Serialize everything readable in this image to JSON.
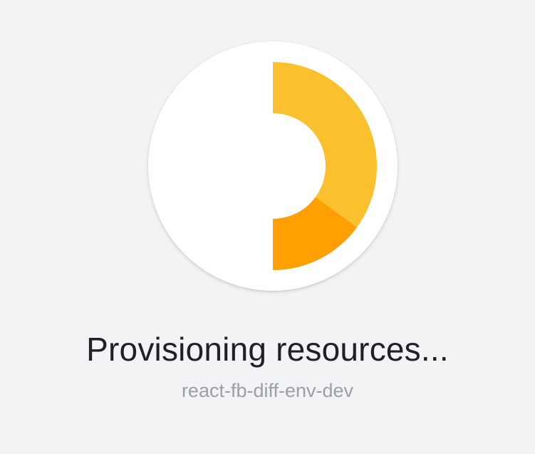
{
  "provisioning": {
    "title": "Provisioning resources...",
    "subtitle": "react-fb-diff-env-dev",
    "progress": {
      "segments": [
        {
          "name": "yellow-segment",
          "fraction": 0.35,
          "color": "#fbc02d"
        },
        {
          "name": "orange-segment",
          "fraction": 0.15,
          "color": "#ffa000"
        }
      ]
    }
  },
  "colors": {
    "background": "#f1f3f4",
    "card": "#ffffff",
    "title_text": "#202124",
    "subtitle_text": "#9aa0a6"
  }
}
